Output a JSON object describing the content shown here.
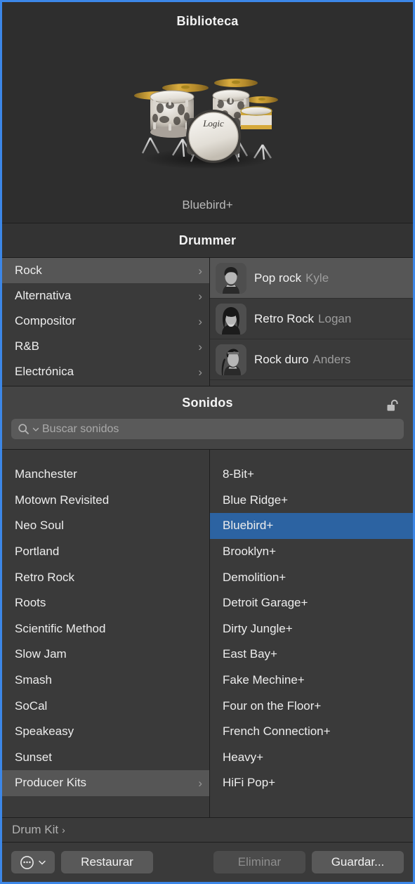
{
  "library": {
    "title": "Biblioteca",
    "artwork_icon": "drum-kit-image",
    "kit_name": "Bluebird+"
  },
  "drummer": {
    "title": "Drummer",
    "genres": [
      {
        "label": "Rock",
        "selected": true
      },
      {
        "label": "Alternativa",
        "selected": false
      },
      {
        "label": "Compositor",
        "selected": false
      },
      {
        "label": "R&B",
        "selected": false
      },
      {
        "label": "Electrónica",
        "selected": false
      }
    ],
    "drummers": [
      {
        "style": "Pop rock",
        "name": "Kyle",
        "selected": true
      },
      {
        "style": "Retro Rock",
        "name": "Logan",
        "selected": false
      },
      {
        "style": "Rock duro",
        "name": "Anders",
        "selected": false
      }
    ]
  },
  "sounds": {
    "title": "Sonidos",
    "lock_icon": "unlocked-padlock-icon",
    "search": {
      "icon": "search-icon",
      "dropdown_icon": "chevron-down-icon",
      "placeholder": "Buscar sonidos",
      "value": ""
    },
    "categories": [
      {
        "label": "Manchester",
        "selected": false,
        "has_chevron": false
      },
      {
        "label": "Motown Revisited",
        "selected": false,
        "has_chevron": false
      },
      {
        "label": "Neo Soul",
        "selected": false,
        "has_chevron": false
      },
      {
        "label": "Portland",
        "selected": false,
        "has_chevron": false
      },
      {
        "label": "Retro Rock",
        "selected": false,
        "has_chevron": false
      },
      {
        "label": "Roots",
        "selected": false,
        "has_chevron": false
      },
      {
        "label": "Scientific Method",
        "selected": false,
        "has_chevron": false
      },
      {
        "label": "Slow Jam",
        "selected": false,
        "has_chevron": false
      },
      {
        "label": "Smash",
        "selected": false,
        "has_chevron": false
      },
      {
        "label": "SoCal",
        "selected": false,
        "has_chevron": false
      },
      {
        "label": "Speakeasy",
        "selected": false,
        "has_chevron": false
      },
      {
        "label": "Sunset",
        "selected": false,
        "has_chevron": false
      },
      {
        "label": "Producer Kits",
        "selected": true,
        "has_chevron": true
      }
    ],
    "patches": [
      {
        "label": "8-Bit+",
        "selected": false
      },
      {
        "label": "Blue Ridge+",
        "selected": false
      },
      {
        "label": "Bluebird+",
        "selected": true
      },
      {
        "label": "Brooklyn+",
        "selected": false
      },
      {
        "label": "Demolition+",
        "selected": false
      },
      {
        "label": "Detroit Garage+",
        "selected": false
      },
      {
        "label": "Dirty Jungle+",
        "selected": false
      },
      {
        "label": "East Bay+",
        "selected": false
      },
      {
        "label": "Fake Mechine+",
        "selected": false
      },
      {
        "label": "Four on the Floor+",
        "selected": false
      },
      {
        "label": "French Connection+",
        "selected": false
      },
      {
        "label": "Heavy+",
        "selected": false
      },
      {
        "label": "HiFi Pop+",
        "selected": false
      }
    ]
  },
  "footer": {
    "breadcrumb": "Drum Kit",
    "breadcrumb_chevron": "chevron-right-icon",
    "menu_icon": "circle-ellipsis-icon",
    "menu_chevron_icon": "chevron-down-icon",
    "restore_label": "Restaurar",
    "delete_label": "Eliminar",
    "save_label": "Guardar..."
  },
  "colors": {
    "window_border": "#3c87e8",
    "selection_blue": "#2c63a2",
    "selection_gray": "#565656",
    "panel_bg": "#3a3a3a",
    "header_bg": "#444444"
  }
}
